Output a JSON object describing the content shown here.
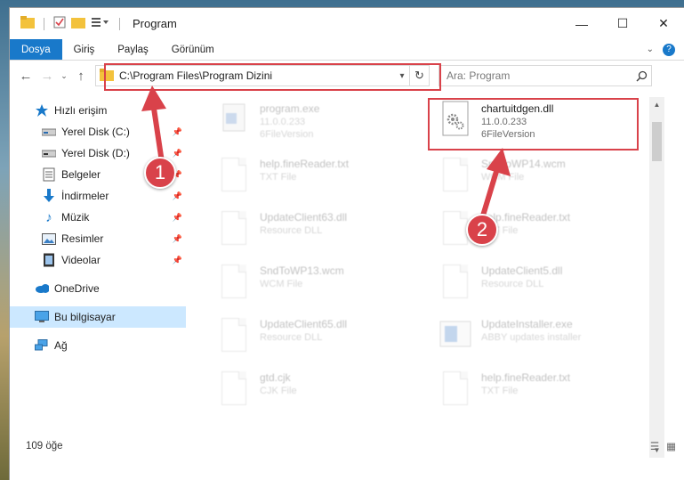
{
  "window": {
    "title": "Program"
  },
  "ribbon": {
    "tabs": [
      "Dosya",
      "Giriş",
      "Paylaş",
      "Görünüm"
    ]
  },
  "address": {
    "path": "C:\\Program Files\\Program Dizini"
  },
  "search": {
    "placeholder": "Ara: Program"
  },
  "sidebar": {
    "items": [
      {
        "label": "Hızlı erişim",
        "icon": "star-icon"
      },
      {
        "label": "Yerel Disk (C:)",
        "icon": "drive-icon",
        "pinned": true
      },
      {
        "label": "Yerel Disk (D:)",
        "icon": "drive-icon",
        "pinned": true
      },
      {
        "label": "Belgeler",
        "icon": "documents-icon",
        "pinned": true
      },
      {
        "label": "İndirmeler",
        "icon": "download-icon",
        "pinned": true
      },
      {
        "label": "Müzik",
        "icon": "music-icon",
        "pinned": true
      },
      {
        "label": "Resimler",
        "icon": "pictures-icon",
        "pinned": true
      },
      {
        "label": "Videolar",
        "icon": "video-icon",
        "pinned": true
      },
      {
        "label": "OneDrive",
        "icon": "cloud-icon"
      },
      {
        "label": "Bu bilgisayar",
        "icon": "computer-icon",
        "selected": true
      },
      {
        "label": "Ağ",
        "icon": "network-icon"
      }
    ]
  },
  "files": [
    {
      "name": "program.exe",
      "line2": "11.0.0.233",
      "line3": "6FileVersion",
      "faded": true
    },
    {
      "name": "chartuitdgen.dll",
      "line2": "11.0.0.233",
      "line3": "6FileVersion",
      "faded": false
    },
    {
      "name": "help.fineReader.txt",
      "line2": "TXT File",
      "line3": "",
      "faded": true
    },
    {
      "name": "SndToWP14.wcm",
      "line2": "WCM File",
      "line3": "",
      "faded": true
    },
    {
      "name": "UpdateClient63.dll",
      "line2": "Resource DLL",
      "line3": "",
      "faded": true
    },
    {
      "name": "help.fineReader.txt",
      "line2": "TXT File",
      "line3": "",
      "faded": true
    },
    {
      "name": "SndToWP13.wcm",
      "line2": "WCM File",
      "line3": "",
      "faded": true
    },
    {
      "name": "UpdateClient5.dll",
      "line2": "Resource DLL",
      "line3": "",
      "faded": true
    },
    {
      "name": "UpdateClient65.dll",
      "line2": "Resource DLL",
      "line3": "",
      "faded": true
    },
    {
      "name": "UpdateInstaller.exe",
      "line2": "ABBY updates installer",
      "line3": "",
      "faded": true
    },
    {
      "name": "gtd.cjk",
      "line2": "CJK File",
      "line3": "",
      "faded": true
    },
    {
      "name": "help.fineReader.txt",
      "line2": "TXT File",
      "line3": "",
      "faded": true
    }
  ],
  "annotations": {
    "badge1": "1",
    "badge2": "2",
    "accent": "#d9424a"
  },
  "status": {
    "count": "109 öğe"
  }
}
